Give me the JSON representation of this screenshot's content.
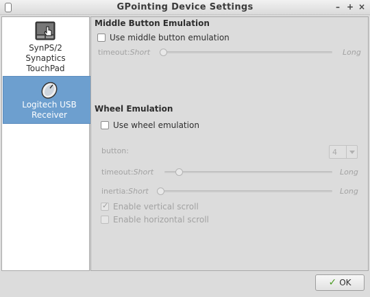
{
  "window": {
    "title": "GPointing Device Settings",
    "controls": {
      "minimize": "–",
      "maximize": "+",
      "close": "×"
    }
  },
  "devices": [
    {
      "label_lines": [
        "SynPS/2",
        "Synaptics",
        "TouchPad"
      ],
      "icon": "touchpad-icon",
      "selected": false
    },
    {
      "label_lines": [
        "Logitech USB",
        "Receiver"
      ],
      "icon": "mouse-icon",
      "selected": true
    }
  ],
  "middle_button": {
    "section_title": "Middle Button Emulation",
    "checkbox_label": "Use middle button emulation",
    "checked": false,
    "timeout": {
      "label": "timeout:",
      "min_label": "Short",
      "max_label": "Long",
      "value_fraction": 0.0
    }
  },
  "wheel": {
    "section_title": "Wheel Emulation",
    "checkbox_label": "Use wheel emulation",
    "checked": false,
    "button": {
      "label": "button:",
      "value": "4"
    },
    "timeout": {
      "label": "timeout:",
      "min_label": "Short",
      "max_label": "Long",
      "value_fraction": 0.07
    },
    "inertia": {
      "label": "inertia:",
      "min_label": "Short",
      "max_label": "Long",
      "value_fraction": 0.0
    },
    "vertical_scroll": {
      "label": "Enable vertical scroll",
      "checked": true
    },
    "horizontal_scroll": {
      "label": "Enable horizontal scroll",
      "checked": false
    }
  },
  "ok_button": {
    "label": "OK",
    "accent": "#4a9a22"
  },
  "colors": {
    "selection": "#6d9fcf",
    "window_bg": "#dcdcdc"
  }
}
